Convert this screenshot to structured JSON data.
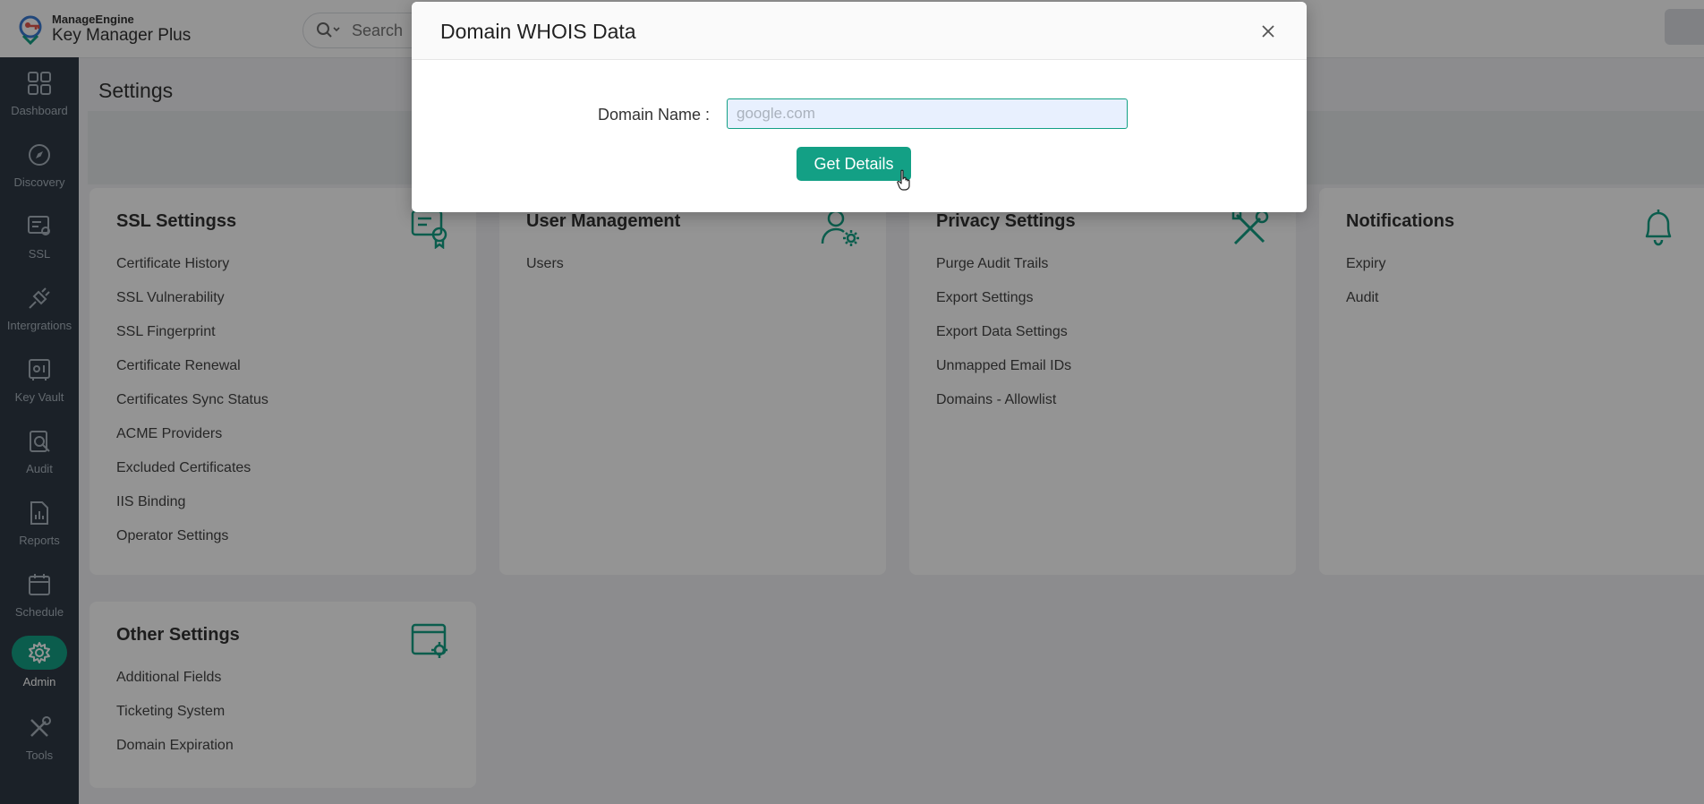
{
  "header": {
    "brand": "ManageEngine",
    "product": "Key Manager Plus",
    "search_placeholder": "Search"
  },
  "sidebar": {
    "items": [
      {
        "label": "Dashboard",
        "icon": "dashboard-icon"
      },
      {
        "label": "Discovery",
        "icon": "compass-icon"
      },
      {
        "label": "SSL",
        "icon": "certificate-icon"
      },
      {
        "label": "Intergrations",
        "icon": "plug-icon"
      },
      {
        "label": "Key Vault",
        "icon": "vault-icon"
      },
      {
        "label": "Audit",
        "icon": "audit-icon"
      },
      {
        "label": "Reports",
        "icon": "reports-icon"
      },
      {
        "label": "Schedule",
        "icon": "calendar-icon"
      },
      {
        "label": "Admin",
        "icon": "gear-icon",
        "active": true
      },
      {
        "label": "Tools",
        "icon": "tools-icon"
      }
    ]
  },
  "page": {
    "title": "Settings"
  },
  "cards": {
    "ssl": {
      "title": "SSL Settingss",
      "links": [
        "Certificate History",
        "SSL Vulnerability",
        "SSL Fingerprint",
        "Certificate Renewal",
        "Certificates Sync Status",
        "ACME Providers",
        "Excluded Certificates",
        "IIS Binding",
        "Operator Settings"
      ]
    },
    "user": {
      "title": "User Management",
      "links": [
        "Users"
      ]
    },
    "privacy": {
      "title": "Privacy Settings",
      "links": [
        "Purge Audit Trails",
        "Export Settings",
        "Export Data Settings",
        "Unmapped Email IDs",
        "Domains - Allowlist"
      ]
    },
    "notifications": {
      "title": "Notifications",
      "links": [
        "Expiry",
        "Audit"
      ]
    },
    "other": {
      "title": "Other Settings",
      "links": [
        "Additional Fields",
        "Ticketing System",
        "Domain Expiration"
      ]
    }
  },
  "modal": {
    "title": "Domain WHOIS Data",
    "field_label": "Domain Name :",
    "field_value": "google.com",
    "button_label": "Get Details"
  },
  "colors": {
    "accent": "#13a085",
    "sidebar": "#2f3a45"
  }
}
